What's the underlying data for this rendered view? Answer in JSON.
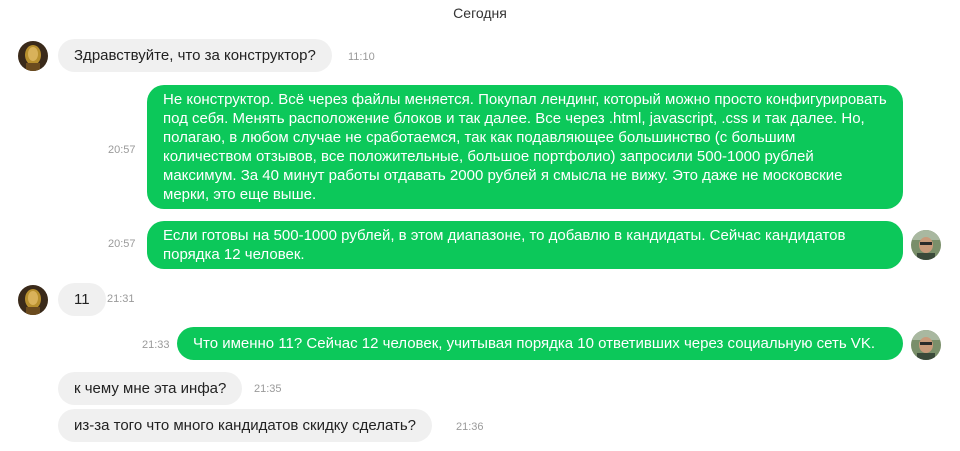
{
  "date_separator": "Сегодня",
  "messages": [
    {
      "direction": "in",
      "text": "Здравствуйте, что за конструктор?",
      "time": "11:10",
      "avatar": "portrait-avatar"
    },
    {
      "direction": "out",
      "text": "Не конструктор. Всё через файлы меняется. Покупал лендинг, который можно просто конфигурировать под себя. Менять расположение блоков и так далее. Все через .html, javascript, .css и так далее. Но, полагаю, в любом случае не сработаемся, так как подавляющее большинство (с большим количеством отзывов, все положительные, большое портфолио) запросили 500-1000 рублей максимум. За 40 минут работы отдавать 2000 рублей я смысла не вижу. Это даже не московские мерки, это еще выше.",
      "time": "20:57"
    },
    {
      "direction": "out",
      "text": "Если готовы на 500-1000 рублей, в этом диапазоне, то добавлю в кандидаты. Сейчас кандидатов порядка 12 человек.",
      "time": "20:57",
      "avatar": "user-photo-avatar"
    },
    {
      "direction": "in",
      "text": "11",
      "time": "21:31",
      "avatar": "portrait-avatar"
    },
    {
      "direction": "out",
      "text": "Что именно 11? Сейчас 12 человек, учитывая порядка 10 ответивших через социальную сеть VK.",
      "time": "21:33",
      "avatar": "user-photo-avatar"
    },
    {
      "direction": "in",
      "text": "к чему мне эта инфа?",
      "time": "21:35"
    },
    {
      "direction": "in",
      "text": "из-за того что много кандидатов скидку сделать?",
      "time": "21:36"
    }
  ],
  "colors": {
    "outgoing_bubble": "#0cc85a",
    "incoming_bubble": "#f0f0f0",
    "timestamp": "#9a9a9a"
  }
}
